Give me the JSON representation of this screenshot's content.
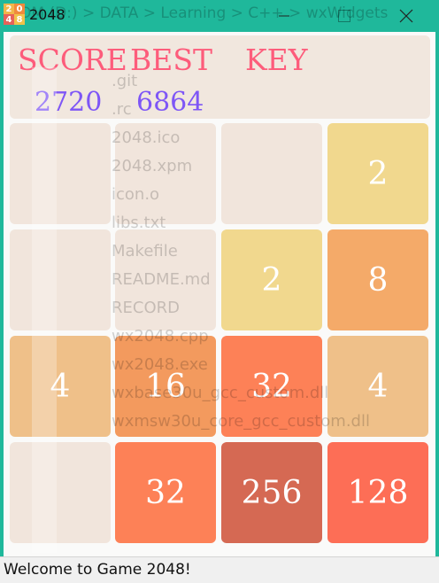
{
  "window": {
    "title": "2048",
    "icon_digits": [
      "2",
      "0",
      "4",
      "8"
    ],
    "background_path_text": "OM (D:)  >  DATA  >  Learning  >  C++  >  wxWidgets"
  },
  "scoreboard": {
    "score_label": "SCORE",
    "best_label": "BEST",
    "key_label": "KEY",
    "score_value": "2720",
    "best_value": "6864",
    "label_color": "#fd5c7b",
    "value_color": "#7e56f6"
  },
  "board": {
    "rows": [
      [
        "",
        "",
        "",
        "2"
      ],
      [
        "",
        "",
        "2",
        "8"
      ],
      [
        "4",
        "16",
        "32",
        "4"
      ],
      [
        "",
        "32",
        "256",
        "128"
      ]
    ],
    "tile_colors": {
      "empty": "#f1e5dc",
      "2": "#f1d88e",
      "4": "#efc089",
      "8": "#f4aa69",
      "16": "#f39a5e",
      "32": "#fd8157",
      "128": "#fd6e56",
      "256": "#d56953"
    }
  },
  "background_files": [
    ".git",
    ".rc",
    "2048.ico",
    "2048.xpm",
    "icon.o",
    "libs.txt",
    "Makefile",
    "README.md",
    "RECORD",
    "wx2048.cpp",
    "wx2048.exe",
    "wxbase30u_gcc_custom.dll",
    "wxmsw30u_core_gcc_custom.dll"
  ],
  "status": {
    "text": "Welcome to Game 2048!"
  }
}
